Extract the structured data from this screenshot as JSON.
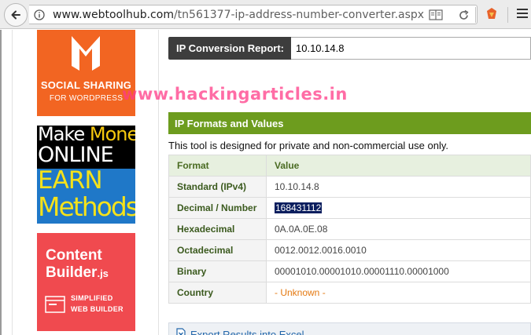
{
  "browser": {
    "url_host": "www.webtoolhub.com",
    "url_path": "/tn561377-ip-address-number-converter.aspx"
  },
  "ads": {
    "social": {
      "line1": "SOCIAL SHARING",
      "line2": "FOR WORDPRESS"
    },
    "money": {
      "make": "Make",
      "money": "Money",
      "online": "ONLINE",
      "earn": "EARN",
      "methods": "Methods"
    },
    "content": {
      "line1": "Content",
      "line2": "Builder",
      "suffix": ".js",
      "line3": "SIMPLIFIED",
      "line4": "WEB BUILDER"
    }
  },
  "watermark": "www.hackingarticles.in",
  "report": {
    "label": "IP Conversion Report:",
    "value": "10.10.14.8"
  },
  "section": {
    "title": "IP Formats and Values",
    "description": "This tool is designed for private and non-commercial use only."
  },
  "table": {
    "headers": [
      "Format",
      "Value"
    ],
    "rows": [
      {
        "format": "Standard (IPv4)",
        "value": "10.10.14.8"
      },
      {
        "format": "Decimal / Number",
        "value": "168431112"
      },
      {
        "format": "Hexadecimal",
        "value": "0A.0A.0E.08"
      },
      {
        "format": "Octadecimal",
        "value": "0012.0012.0016.0010"
      },
      {
        "format": "Binary",
        "value": "00001010.00001010.00001110.00001000"
      },
      {
        "format": "Country",
        "value": "- Unknown -"
      }
    ]
  },
  "export": {
    "label": "Export Results into Excel"
  },
  "colors": {
    "section_green": "#6d9c1e",
    "report_dark": "#3d3d3d",
    "selection": "#0b1e5e",
    "unknown_orange": "#e47911"
  }
}
